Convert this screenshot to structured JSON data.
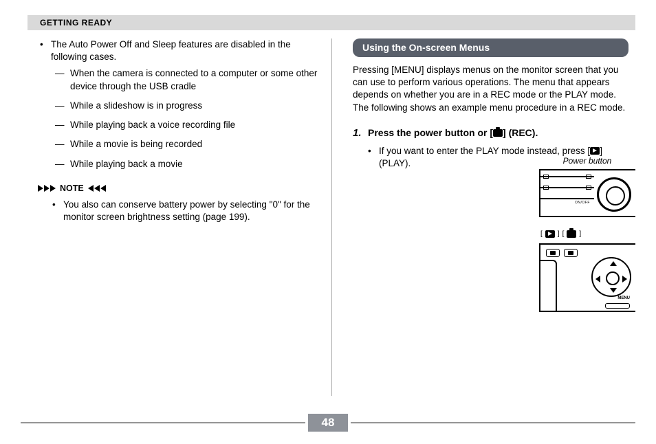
{
  "header": {
    "section": "GETTING READY"
  },
  "left": {
    "main_bullet": "The Auto Power Off and Sleep features are disabled in the following cases.",
    "dashes": [
      "When the camera is connected to a computer or some other device through the USB cradle",
      "While a slideshow is in progress",
      "While playing back a voice recording file",
      "While a movie is being recorded",
      "While playing back a movie"
    ],
    "note_label": "NOTE",
    "note_bullet": "You also can conserve battery power by selecting \"0\" for the monitor screen brightness setting (page 199)."
  },
  "right": {
    "section_title": "Using the On-screen Menus",
    "intro": "Pressing [MENU] displays menus on the monitor screen that you can use to perform various operations. The menu that appears depends on whether you are in a REC mode or the PLAY mode. The following shows an example menu procedure in a REC mode.",
    "step_num": "1.",
    "step_title_a": "Press the power button or [",
    "step_title_b": "] (REC).",
    "step_sub_a": "If you want to enter the PLAY mode instead, press [",
    "step_sub_b": "] (PLAY).",
    "fig_label": "Power button",
    "onoff": "ON/OFF",
    "menu": "MENU"
  },
  "page_number": "48"
}
